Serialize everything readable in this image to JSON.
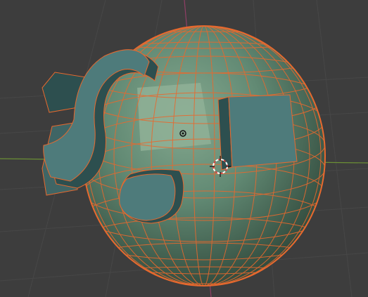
{
  "viewport": {
    "background": "#3d3d3d",
    "grid_color": "#474747",
    "grid_on": true
  },
  "scene": {
    "object_name": "Sphere",
    "mode": "edit",
    "mesh_type": "uv-sphere",
    "wireframe_color": "#e8692e",
    "base_face_color": "#5d8270",
    "selected_face_color": "#8fb097",
    "extruded_face_color": "#4e7b7b",
    "extrusion_side_color": "#2d4f4f"
  },
  "axes": {
    "x_axis_color": "#6b8f35",
    "y_axis_color": "#9a3f6b"
  },
  "overlays": {
    "cursor_icon": "3d-cursor-icon",
    "origin_icon": "object-origin-icon"
  }
}
